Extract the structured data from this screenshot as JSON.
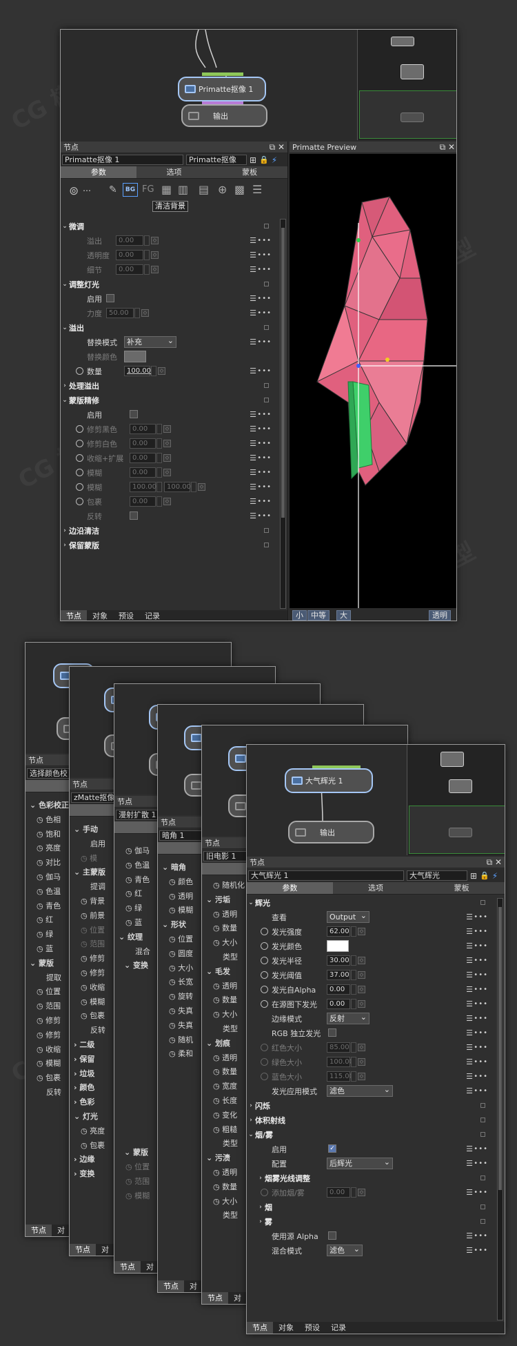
{
  "watermark": "CG 模型",
  "top_window": {
    "node_graph": {
      "node_main": "Primatte抠像 1",
      "node_output": "输出"
    },
    "panel_title": "节点",
    "node_name": "Primatte抠像 1",
    "node_type": "Primatte抠像",
    "tabs": [
      "参数",
      "选项",
      "蒙板"
    ],
    "tooltip": "清洁背景",
    "rows": {
      "fine_tune": "微调",
      "spill": "溢出",
      "transparency": "透明度",
      "detail": "细节",
      "adjust_light": "调整灯光",
      "enable": "启用",
      "strength": "力度",
      "spill_sec": "溢出",
      "replace_mode": "替换模式",
      "replace_mode_val": "补充",
      "replace_color": "替换颜色",
      "amount": "数量",
      "process_spill": "处理溢出",
      "matte_refine": "蒙版精修",
      "enable2": "启用",
      "clip_black": "修剪黑色",
      "clip_white": "修剪白色",
      "shrink_grow": "收缩+扩展",
      "blur": "模糊",
      "blur2": "模糊",
      "wrap": "包裹",
      "invert": "反转",
      "edge_clean": "边沿清洁",
      "keep_matte": "保留蒙版"
    },
    "values": {
      "v000": "0.00",
      "v50": "50.00",
      "v100": "100.00"
    },
    "preview": {
      "title": "Primatte Preview",
      "btn_small": "小",
      "btn_medium": "中等",
      "btn_large": "大",
      "btn_transparent": "透明"
    },
    "bottom_tabs": [
      "节点",
      "对象",
      "预设",
      "记录"
    ]
  },
  "stack": {
    "panel_title": "节点",
    "p1": {
      "name": "选择颜色校",
      "tab": "参",
      "items": [
        "色彩校正",
        "色相",
        "饱和",
        "亮度",
        "对比",
        "伽马",
        "色温",
        "青色",
        "红",
        "绿",
        "蓝",
        "蒙版",
        "提取",
        "位置",
        "范围",
        "修剪",
        "修剪",
        "收缩",
        "模糊",
        "包裹",
        "反转"
      ],
      "bottom": [
        "节点",
        "对"
      ]
    },
    "p2": {
      "name": "zMatte抠像",
      "tab": "参",
      "items": [
        "手动",
        "启用",
        "模",
        "主蒙版",
        "提调",
        "背景",
        "前景",
        "位置",
        "范围",
        "修剪",
        "修剪",
        "收缩",
        "模糊",
        "包裹",
        "反转",
        "二级",
        "保留",
        "垃圾",
        "颜色",
        "色彩",
        "灯光",
        "亮度",
        "包裹",
        "边缘",
        "变换"
      ],
      "bottom": [
        "节点",
        "对"
      ]
    },
    "p3": {
      "name": "漫射扩散 1",
      "tab": "参",
      "items": [
        "伽马",
        "色温",
        "青色",
        "红",
        "绿",
        "蓝",
        "纹理",
        "混合",
        "变换",
        "蒙版",
        "位置",
        "范围",
        "模糊"
      ],
      "bottom": [
        "节点",
        "对"
      ]
    },
    "p4": {
      "name": "暗角 1",
      "tab": "参",
      "items": [
        "暗角",
        "颜色",
        "透明",
        "模糊",
        "形状",
        "位置",
        "圆度",
        "大小",
        "长宽",
        "旋转",
        "失真",
        "失真",
        "随机",
        "柔和"
      ],
      "bottom": [
        "节点",
        "对"
      ]
    },
    "p5": {
      "name": "旧电影 1",
      "tab": "参",
      "items": [
        "随机化",
        "污垢",
        "透明",
        "数量",
        "大小",
        "类型",
        "毛发",
        "透明",
        "数量",
        "大小",
        "类型",
        "划痕",
        "透明",
        "数量",
        "宽度",
        "长度",
        "变化",
        "粗糙",
        "类型",
        "污渍",
        "透明",
        "数量",
        "大小",
        "类型"
      ],
      "bottom": [
        "节点",
        "对"
      ]
    }
  },
  "glow_window": {
    "node_graph": {
      "node_main": "大气辉光 1",
      "node_output": "输出"
    },
    "panel_title": "节点",
    "node_name": "大气辉光 1",
    "node_type": "大气辉光",
    "tabs": [
      "参数",
      "选项",
      "蒙板"
    ],
    "rows": {
      "glow": "辉光",
      "view": "查看",
      "view_val": "Output",
      "intensity": "发光强度",
      "intensity_val": "62.00",
      "color": "发光颜色",
      "radius": "发光半径",
      "radius_val": "30.00",
      "threshold": "发光阈值",
      "threshold_val": "37.00",
      "from_alpha": "发光自Alpha",
      "from_alpha_val": "0.00",
      "under_source": "在源图下发光",
      "under_source_val": "0.00",
      "edge_mode": "边缘模式",
      "edge_mode_val": "反射",
      "rgb_independent": "RGB 独立发光",
      "red_size": "红色大小",
      "red_size_val": "85.00",
      "green_size": "绿色大小",
      "green_size_val": "100.00",
      "blue_size": "蓝色大小",
      "blue_size_val": "115.00",
      "apply_mode": "发光应用模式",
      "apply_mode_val": "滤色",
      "flash": "闪烁",
      "volume_light": "体积射线",
      "smoke_fog": "烟/雾",
      "enable": "启用",
      "config": "配置",
      "config_val": "后辉光",
      "smoke_adjust": "烟雾光线调整",
      "add_smoke": "添加烟/雾",
      "add_smoke_val": "0.00",
      "smoke": "烟",
      "fog": "雾",
      "use_alpha": "使用源 Alpha",
      "blend_mode": "混合模式",
      "blend_mode_val": "滤色"
    },
    "bottom_tabs": [
      "节点",
      "对象",
      "预设",
      "记录"
    ]
  },
  "colors": {
    "mesh_pink": "#e0607e",
    "mesh_green": "#3fcf6a",
    "accent_blue": "#4a6fa0"
  }
}
